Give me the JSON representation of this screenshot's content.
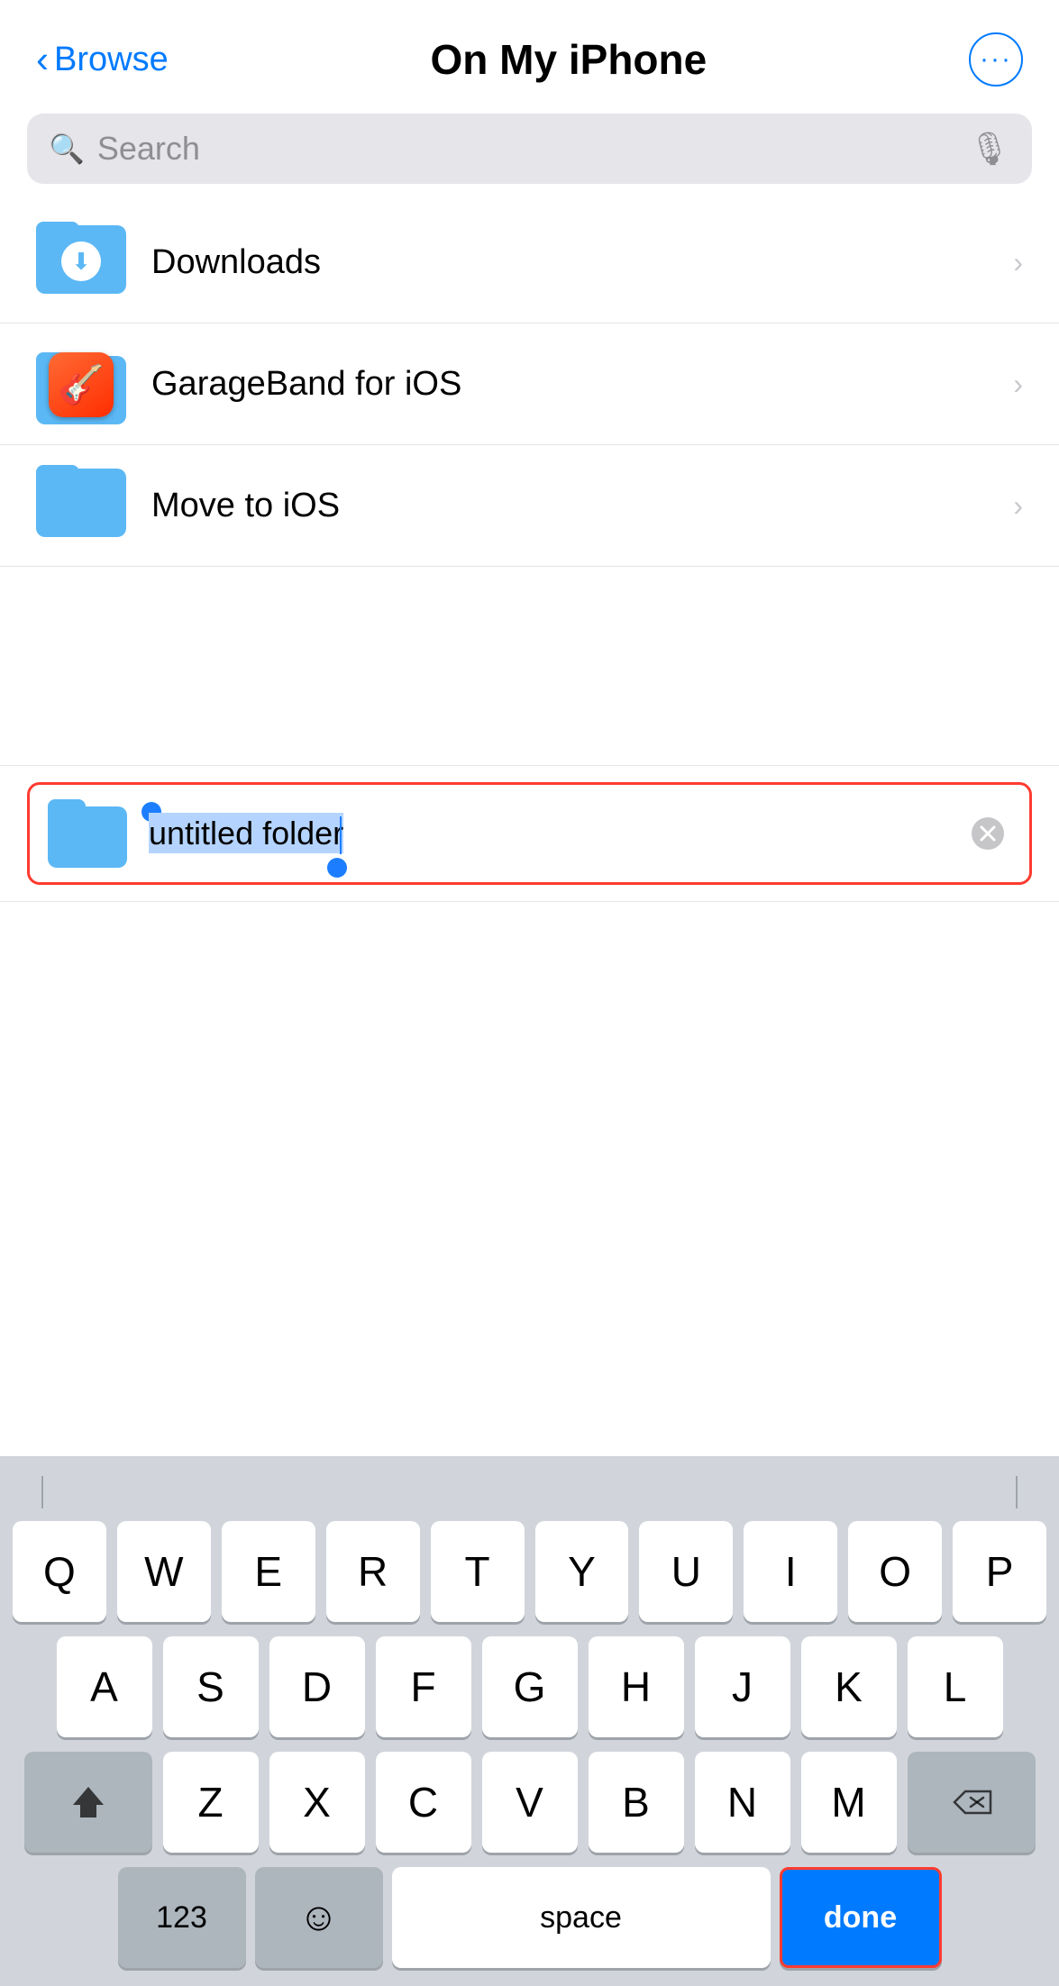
{
  "header": {
    "back_label": "Browse",
    "title": "On My iPhone",
    "more_icon": "···"
  },
  "search": {
    "placeholder": "Search",
    "search_icon": "🔍",
    "mic_icon": "🎤"
  },
  "files": [
    {
      "id": "downloads",
      "name": "Downloads",
      "icon_type": "downloads-folder"
    },
    {
      "id": "garageband",
      "name": "GarageBand for iOS",
      "icon_type": "garageband-folder"
    },
    {
      "id": "movetoisos",
      "name": "Move to iOS",
      "icon_type": "plain-folder"
    }
  ],
  "rename": {
    "folder_name": "untitled folder",
    "clear_icon": "⊗"
  },
  "keyboard": {
    "rows": [
      [
        "Q",
        "W",
        "E",
        "R",
        "T",
        "Y",
        "U",
        "I",
        "O",
        "P"
      ],
      [
        "A",
        "S",
        "D",
        "F",
        "G",
        "H",
        "J",
        "K",
        "L"
      ],
      [
        "Z",
        "X",
        "C",
        "V",
        "B",
        "N",
        "M"
      ]
    ],
    "bottom": {
      "numbers_label": "123",
      "emoji_label": "☺",
      "space_label": "space",
      "done_label": "done"
    }
  }
}
